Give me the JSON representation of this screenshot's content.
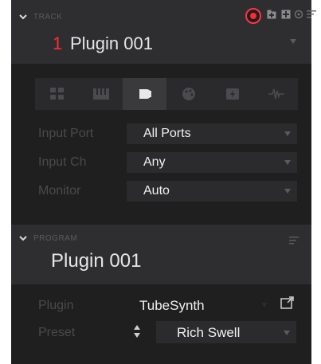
{
  "track": {
    "caption": "TRACK",
    "number": "1",
    "name": "Plugin 001"
  },
  "tabs": [
    {
      "name": "grid-view-icon",
      "active": false
    },
    {
      "name": "keyboard-icon",
      "active": false
    },
    {
      "name": "plug-icon",
      "active": true
    },
    {
      "name": "palette-icon",
      "active": false
    },
    {
      "name": "lightning-icon",
      "active": false
    },
    {
      "name": "waveform-icon",
      "active": false
    }
  ],
  "rows": {
    "input_port": {
      "label": "Input Port",
      "value": "All Ports"
    },
    "input_ch": {
      "label": "Input Ch",
      "value": "Any"
    },
    "monitor": {
      "label": "Monitor",
      "value": "Auto"
    }
  },
  "program": {
    "caption": "PROGRAM",
    "name": "Plugin 001",
    "plugin_label": "Plugin",
    "plugin_value": "TubeSynth",
    "preset_label": "Preset",
    "preset_value": "Rich Swell"
  },
  "colors": {
    "accent": "#ff2a33",
    "panel_bg": "#1f1f20",
    "header_bg": "#2e2e30"
  }
}
